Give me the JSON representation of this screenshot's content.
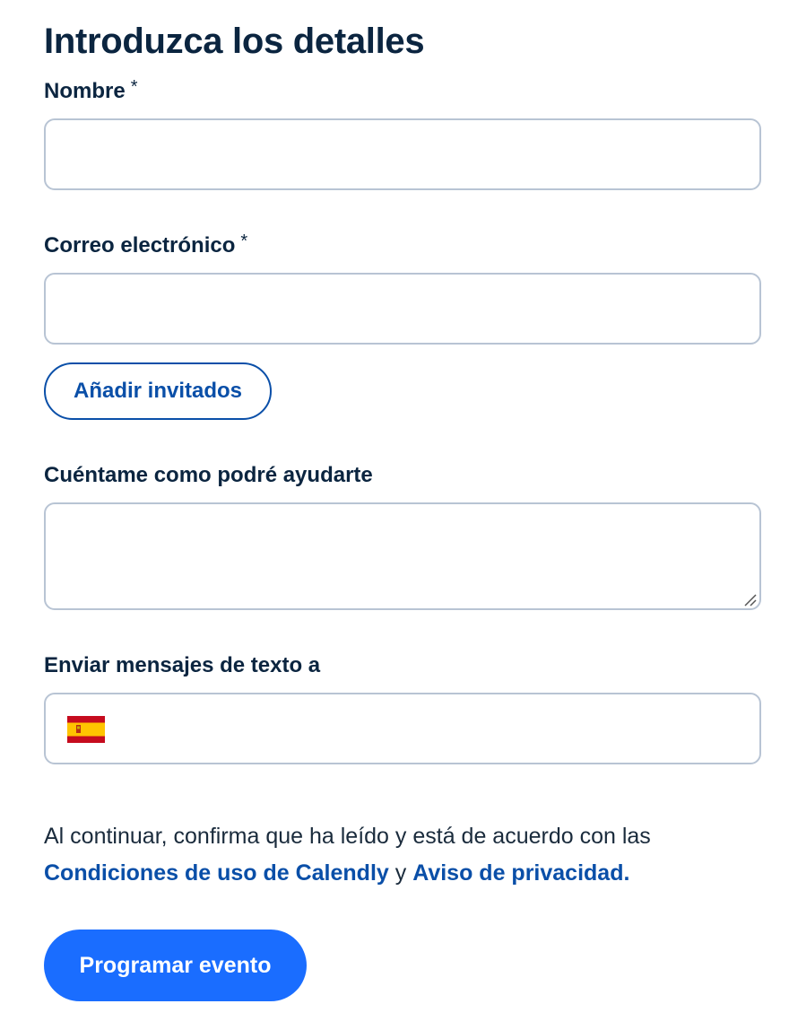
{
  "form": {
    "title": "Introduzca los detalles",
    "name_label": "Nombre",
    "name_required_mark": "*",
    "name_value": "",
    "email_label": "Correo electrónico",
    "email_required_mark": "*",
    "email_value": "",
    "add_guests_label": "Añadir invitados",
    "notes_label": "Cuéntame como podré ayudarte",
    "notes_value": "",
    "sms_label": "Enviar mensajes de texto a",
    "phone_country_icon": "spain-flag-icon",
    "phone_value": "",
    "legal_text_1": "Al continuar, confirma que ha leído y está de acuerdo con las",
    "terms_link_label": "Condiciones de uso de Calendly",
    "legal_conjunction": " y ",
    "privacy_link_label": "Aviso de privacidad.",
    "submit_label": "Programar evento"
  },
  "colors": {
    "primary": "#1a6dff",
    "link": "#0a4fa8",
    "heading": "#0b2540",
    "input_border": "#b8c4d4"
  }
}
